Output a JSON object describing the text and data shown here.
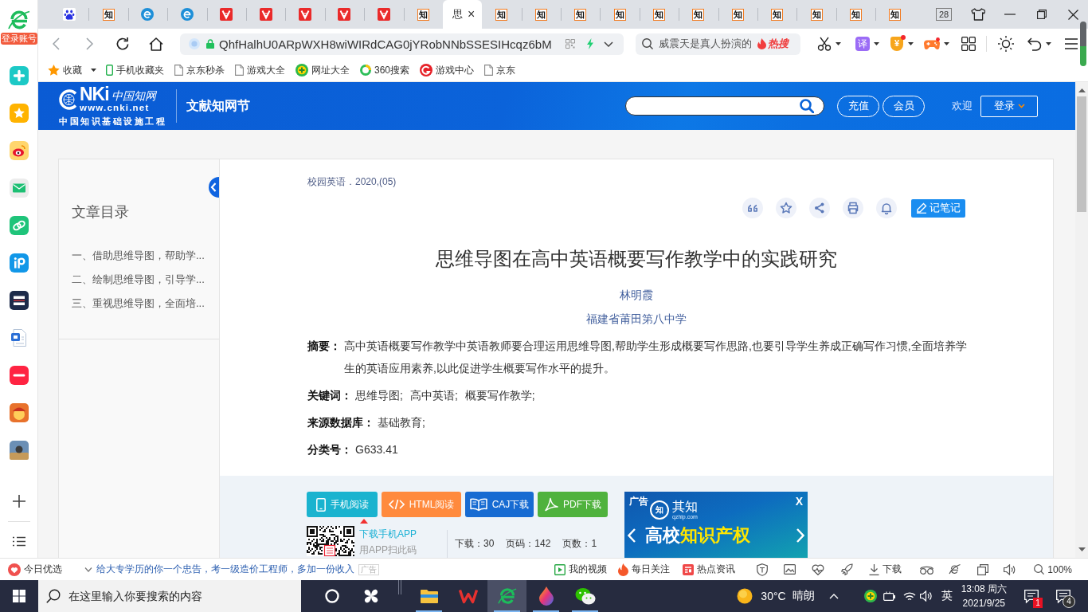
{
  "sidebar": {
    "account_label": "登录账号"
  },
  "tabs": [
    {
      "kind": "paw",
      "selected": false
    },
    {
      "kind": "cnki",
      "glyph": "知",
      "selected": false
    },
    {
      "kind": "globe",
      "selected": false
    },
    {
      "kind": "globe",
      "selected": false
    },
    {
      "kind": "v",
      "selected": false
    },
    {
      "kind": "v",
      "selected": false
    },
    {
      "kind": "v",
      "selected": false
    },
    {
      "kind": "v",
      "selected": false
    },
    {
      "kind": "v",
      "selected": false
    },
    {
      "kind": "cnki",
      "glyph": "知",
      "selected": false
    },
    {
      "kind": "page",
      "title": "思",
      "close": "×",
      "selected": true
    },
    {
      "kind": "cnki",
      "glyph": "知",
      "selected": false
    },
    {
      "kind": "cnki",
      "glyph": "知",
      "selected": false
    },
    {
      "kind": "cnki",
      "glyph": "知",
      "selected": false
    },
    {
      "kind": "cnki",
      "glyph": "知",
      "selected": false
    },
    {
      "kind": "cnki",
      "glyph": "知",
      "selected": false
    },
    {
      "kind": "cnki",
      "glyph": "知",
      "selected": false
    },
    {
      "kind": "cnki",
      "glyph": "知",
      "selected": false
    },
    {
      "kind": "cnki",
      "glyph": "知",
      "selected": false
    },
    {
      "kind": "cnki",
      "glyph": "知",
      "selected": false
    },
    {
      "kind": "cnki",
      "glyph": "知",
      "selected": false
    },
    {
      "kind": "cnki",
      "glyph": "知",
      "selected": false
    }
  ],
  "window": {
    "tab_count": "28"
  },
  "toolbar": {
    "url": "QhfHalhU0ARpWXH8wiWIRdCAG0jYRobNNbSSESIHcqz6bM",
    "search": {
      "placeholder": "威震天是真人扮演的",
      "badge": "热搜"
    },
    "translate_glyph": "译",
    "wallet_glyph": "¥"
  },
  "bookmarks": [
    {
      "kind": "star",
      "label": "收藏",
      "menu": true
    },
    {
      "kind": "phone",
      "label": "手机收藏夹",
      "menu": false
    },
    {
      "kind": "page",
      "label": "京东秒杀",
      "menu": false
    },
    {
      "kind": "page",
      "label": "游戏大全",
      "menu": false
    },
    {
      "kind": "plus",
      "label": "网址大全",
      "menu": false
    },
    {
      "kind": "ring",
      "label": "360搜索",
      "menu": false
    },
    {
      "kind": "swirl",
      "label": "游戏中心",
      "menu": false
    },
    {
      "kind": "page",
      "label": "京东",
      "menu": false
    }
  ],
  "site_header": {
    "logo": {
      "mark": "NKi",
      "name": "中国知网",
      "url": "www.cnki.net",
      "tagline": "中国知识基础设施工程"
    },
    "section": "文献知网节",
    "buttons": [
      "充值",
      "会员"
    ],
    "welcome": "欢迎",
    "login": "登录"
  },
  "outline": {
    "title": "文章目录",
    "items": [
      "一、借助思维导图，帮助学...",
      "二、绘制思维导图，引导学...",
      "三、重视思维导图，全面培..."
    ]
  },
  "article": {
    "source": "校园英语．2020,(05)",
    "note_button": "记笔记",
    "title": "思维导图在高中英语概要写作教学中的实践研究",
    "author": "林明霞",
    "organization": "福建省莆田第八中学",
    "fields": [
      {
        "kind": "text",
        "label": "摘要：",
        "text": "高中英语概要写作教学中英语教师要合理运用思维导图,帮助学生形成概要写作思路,也要引导学生养成正确写作习惯,全面培养学生的英语应用素养,以此促进学生概要写作水平的提升。"
      },
      {
        "kind": "links",
        "label": "关键词：",
        "items": [
          "思维导图;",
          "高中英语;",
          "概要写作教学;"
        ]
      },
      {
        "kind": "links",
        "label": "来源数据库：",
        "items": [
          "基础教育;"
        ]
      },
      {
        "kind": "code",
        "label": "分类号：",
        "text": "G633.41"
      }
    ]
  },
  "downloads": {
    "buttons": [
      {
        "kind": "phone",
        "label": "手机阅读",
        "color": "#1ab3cf"
      },
      {
        "kind": "code",
        "label": "HTML阅读",
        "color": "#ff8a3d"
      },
      {
        "kind": "book",
        "label": "CAJ下载",
        "color": "#176bd2"
      },
      {
        "kind": "pdf",
        "label": "PDF下载",
        "color": "#4fb23d"
      }
    ],
    "app_label": "下载手机APP",
    "app_hint": "用APP扫此码",
    "stats": [
      "下载：30",
      "页码：142",
      "页数：1"
    ]
  },
  "ad": {
    "tag": "广告",
    "logo_glyph": "知",
    "brand": "其知",
    "domain": "qzhip.com",
    "headline": [
      {
        "text": "高校",
        "highlight": false
      },
      {
        "text": "知识产权",
        "highlight": true
      }
    ],
    "close": "X"
  },
  "status_bar": {
    "featured": "今日优选",
    "news": "给大专学历的你一个忠告，考一级造价工程师，多加一份收入",
    "news_tag": "广告",
    "items": [
      {
        "kind": "video",
        "label": "我的视频"
      },
      {
        "kind": "flame",
        "label": "每日关注"
      },
      {
        "kind": "news",
        "label": "热点资讯"
      },
      {
        "kind": "shield"
      },
      {
        "kind": "image"
      },
      {
        "kind": "pulse"
      },
      {
        "kind": "rocket"
      },
      {
        "kind": "download",
        "label": "下载"
      },
      {
        "kind": "glasses"
      },
      {
        "kind": "e"
      },
      {
        "kind": "window"
      },
      {
        "kind": "speaker"
      },
      {
        "kind": "zoom",
        "label": "100%"
      }
    ]
  },
  "taskbar": {
    "search": {
      "placeholder": "在这里输入你要搜索的内容"
    },
    "apps": [
      {
        "kind": "cortana",
        "running": false,
        "selected": false
      },
      {
        "kind": "pinwheel",
        "running": false,
        "selected": false
      },
      {
        "kind": "explorer",
        "running": true,
        "selected": false
      },
      {
        "kind": "wps",
        "running": false,
        "selected": false
      },
      {
        "kind": "browser",
        "running": true,
        "selected": true
      },
      {
        "kind": "drop",
        "running": true,
        "selected": false
      },
      {
        "kind": "wechat",
        "running": true,
        "selected": false
      }
    ],
    "weather": {
      "temperature": "30°C",
      "condition": "晴朗"
    },
    "input_method": "英",
    "time": "13:08 周六",
    "date": "2021/9/25",
    "notifications": "1",
    "messages": "4"
  }
}
